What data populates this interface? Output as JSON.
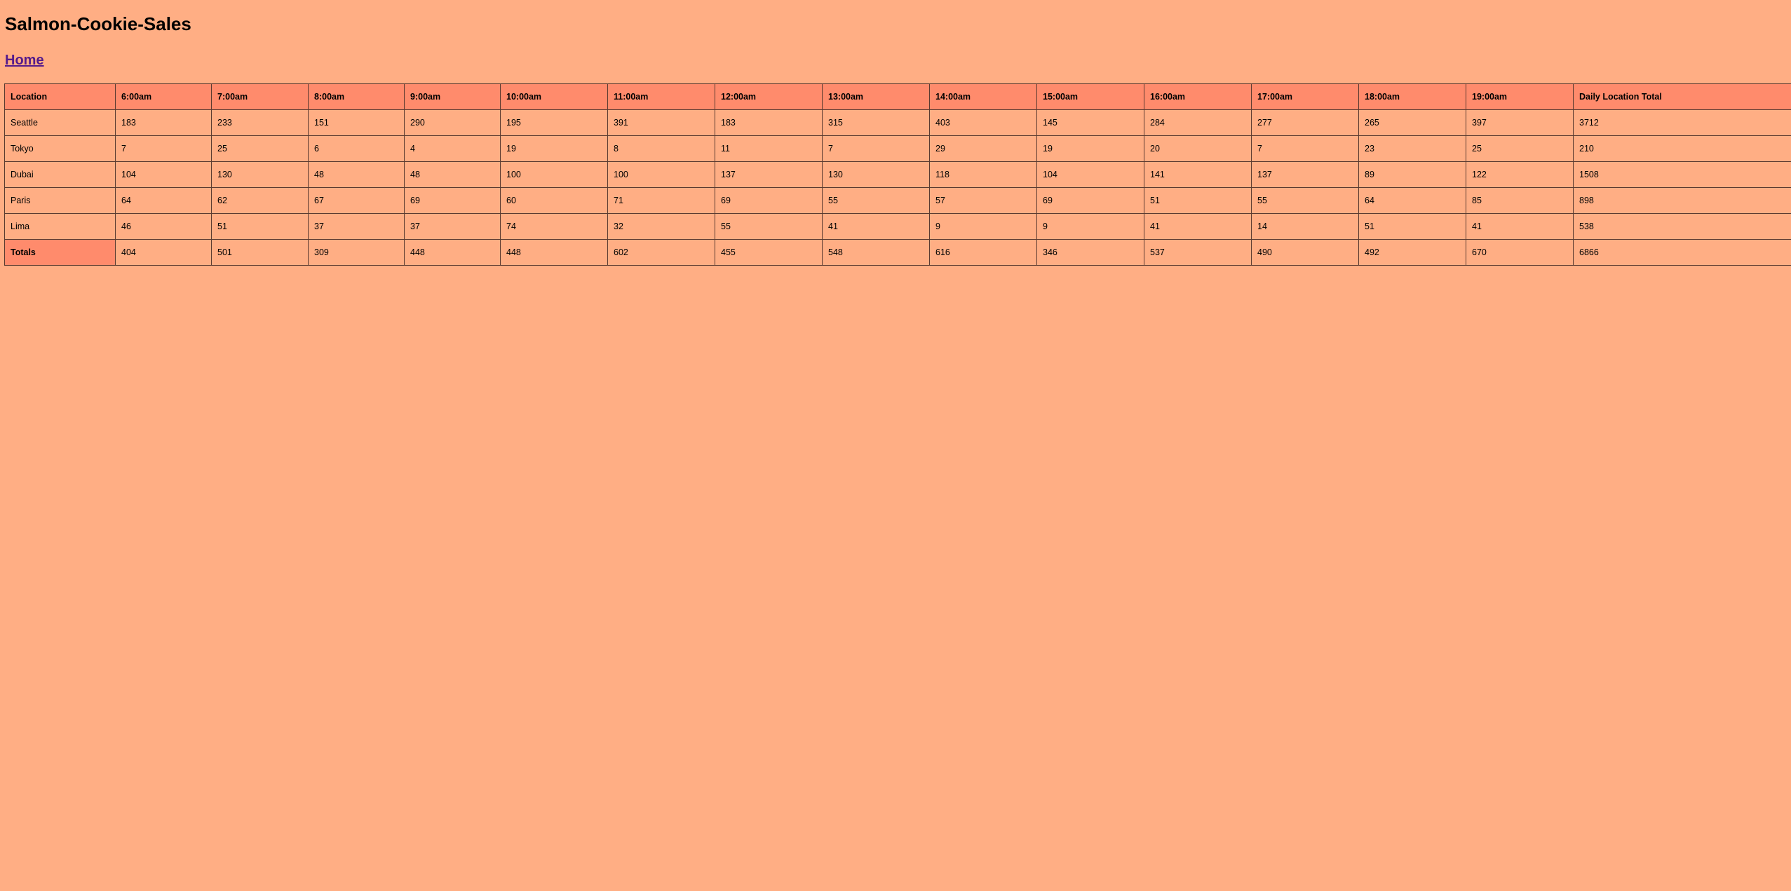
{
  "page": {
    "title": "Salmon-Cookie-Sales",
    "nav_home": "Home"
  },
  "colors": {
    "background": "#ffae84",
    "header_cell": "#ff8b6c",
    "link": "#551a8b"
  },
  "table": {
    "headers": [
      "Location",
      "6:00am",
      "7:00am",
      "8:00am",
      "9:00am",
      "10:00am",
      "11:00am",
      "12:00am",
      "13:00am",
      "14:00am",
      "15:00am",
      "16:00am",
      "17:00am",
      "18:00am",
      "19:00am",
      "Daily Location Total"
    ],
    "rows": [
      [
        "Seattle",
        "183",
        "233",
        "151",
        "290",
        "195",
        "391",
        "183",
        "315",
        "403",
        "145",
        "284",
        "277",
        "265",
        "397",
        "3712"
      ],
      [
        "Tokyo",
        "7",
        "25",
        "6",
        "4",
        "19",
        "8",
        "11",
        "7",
        "29",
        "19",
        "20",
        "7",
        "23",
        "25",
        "210"
      ],
      [
        "Dubai",
        "104",
        "130",
        "48",
        "48",
        "100",
        "100",
        "137",
        "130",
        "118",
        "104",
        "141",
        "137",
        "89",
        "122",
        "1508"
      ],
      [
        "Paris",
        "64",
        "62",
        "67",
        "69",
        "60",
        "71",
        "69",
        "55",
        "57",
        "69",
        "51",
        "55",
        "64",
        "85",
        "898"
      ],
      [
        "Lima",
        "46",
        "51",
        "37",
        "37",
        "74",
        "32",
        "55",
        "41",
        "9",
        "9",
        "41",
        "14",
        "51",
        "41",
        "538"
      ]
    ],
    "totals": [
      "Totals",
      "404",
      "501",
      "309",
      "448",
      "448",
      "602",
      "455",
      "548",
      "616",
      "346",
      "537",
      "490",
      "492",
      "670",
      "6866"
    ]
  }
}
